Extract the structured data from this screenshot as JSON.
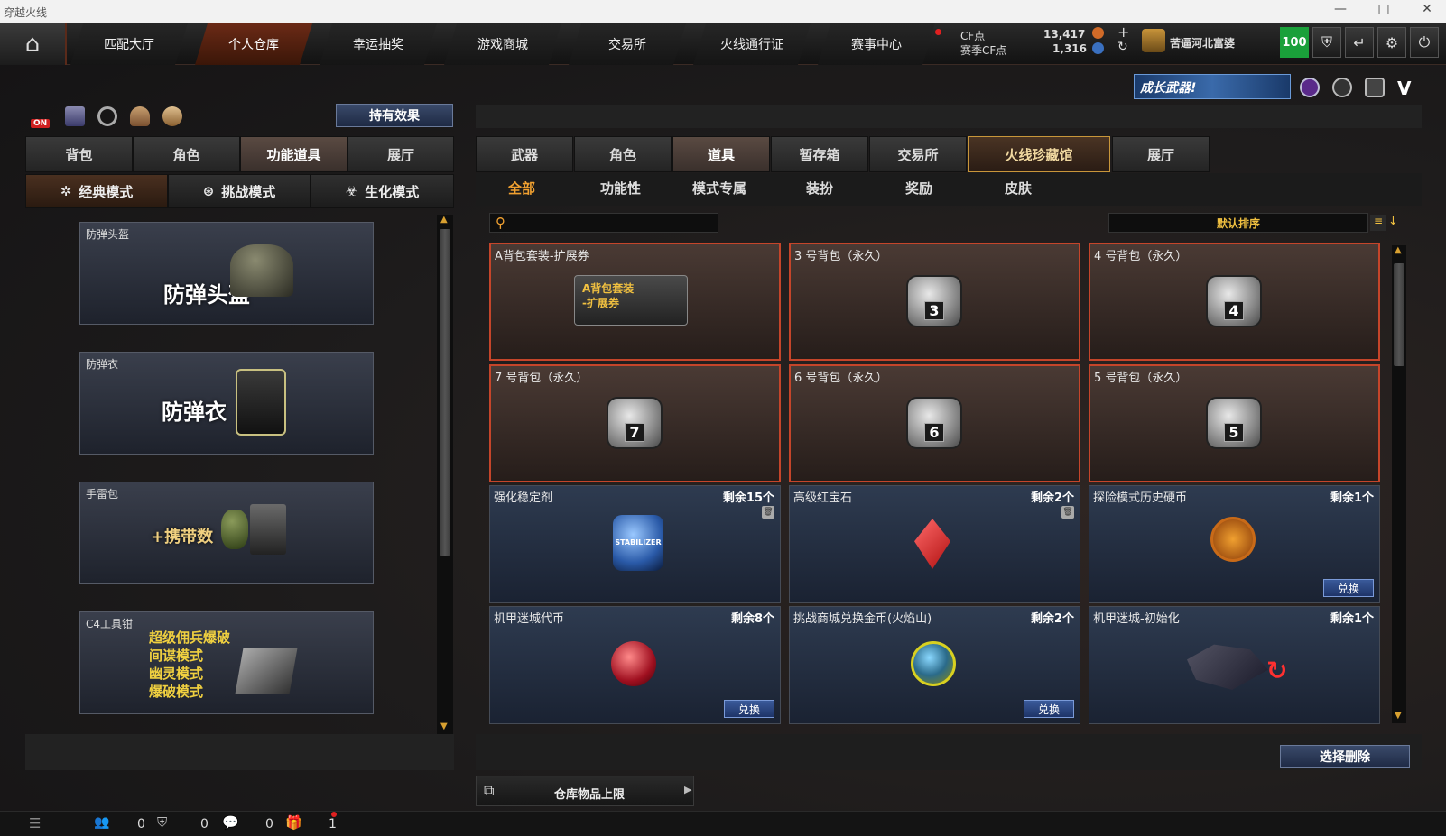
{
  "window": {
    "title": "穿越火线",
    "controls": [
      "—",
      "□",
      "✕"
    ]
  },
  "topnav": {
    "tabs": [
      "匹配大厅",
      "个人仓库",
      "幸运抽奖",
      "游戏商城",
      "交易所",
      "火线通行证",
      "赛事中心"
    ],
    "active_tab": "个人仓库",
    "cf_label": "CF点",
    "cf_value": "13,417",
    "match_cf_label": "赛季CF点",
    "match_cf_value": "1,316",
    "plus": "+",
    "refresh": "↻",
    "rank_name": "苦逼河北富婆",
    "level": "100"
  },
  "banner": {
    "text": "成长武器!"
  },
  "left": {
    "toggle_on": "ON",
    "effects_button": "持有效果",
    "tabs": [
      "背包",
      "角色",
      "功能道具",
      "展厅"
    ],
    "active_tab": "功能道具",
    "modes": [
      "经典模式",
      "挑战模式",
      "生化模式"
    ],
    "active_mode": "经典模式",
    "cards": [
      {
        "label": "防弹头盔",
        "big": "防弹头盔"
      },
      {
        "label": "防弹衣",
        "big": "防弹衣"
      },
      {
        "label": "手雷包",
        "big": "+携带数"
      },
      {
        "label": "C4工具钳",
        "lines": [
          "超级佣兵爆破",
          "间谍模式",
          "幽灵模式",
          "爆破模式"
        ]
      }
    ]
  },
  "right": {
    "tabs": [
      "武器",
      "角色",
      "道具",
      "暂存箱",
      "交易所",
      "火线珍藏馆",
      "展厅"
    ],
    "active_tab": "道具",
    "gold_tab": "火线珍藏馆",
    "subtabs": [
      "全部",
      "功能性",
      "模式专属",
      "装扮",
      "奖励",
      "皮肤"
    ],
    "active_subtab": "全部",
    "sort_label": "默认排序",
    "items": [
      {
        "name": "A背包套装-扩展券",
        "count": "",
        "icon_text": "A背包套装\n-扩展券"
      },
      {
        "name": "3 号背包（永久）",
        "count": "",
        "bag": "3"
      },
      {
        "name": "4 号背包（永久）",
        "count": "",
        "bag": "4"
      },
      {
        "name": "7 号背包（永久）",
        "count": "",
        "bag": "7"
      },
      {
        "name": "6 号背包（永久）",
        "count": "",
        "bag": "6"
      },
      {
        "name": "5 号背包（永久）",
        "count": "",
        "bag": "5"
      },
      {
        "name": "强化稳定剂",
        "count": "剩余15个",
        "icon_text": "STABILIZER"
      },
      {
        "name": "高级红宝石",
        "count": "剩余2个"
      },
      {
        "name": "探险模式历史硬币",
        "count": "剩余1个",
        "button": "兑换"
      },
      {
        "name": "机甲迷城代币",
        "count": "剩余8个",
        "button": "兑换"
      },
      {
        "name": "挑战商城兑换金币(火焰山)",
        "count": "剩余2个",
        "button": "兑换"
      },
      {
        "name": "机甲迷城-初始化",
        "count": "剩余1个"
      }
    ],
    "select_delete": "选择删除",
    "storage_limit": "仓库物品上限"
  },
  "statusbar": {
    "counts": [
      "0",
      "0",
      "0",
      "1"
    ]
  }
}
